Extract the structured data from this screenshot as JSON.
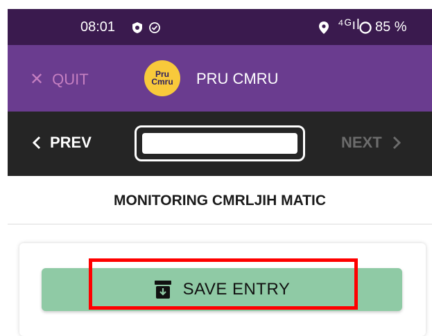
{
  "status_bar": {
    "time": "08:01",
    "signal_text": "⁴ᴳıl",
    "battery": "85 %"
  },
  "header": {
    "quit_label": "QUIT",
    "logo_text": "Pru Cmru",
    "app_name": "PRU CMRU"
  },
  "nav": {
    "prev_label": "PREV",
    "next_label": "NEXT",
    "page_value": ""
  },
  "form": {
    "title": "MONITORING CMRLJIH MATIC",
    "save_label": "SAVE ENTRY"
  },
  "colors": {
    "status_bg": "#3a1a4e",
    "header_bg": "#6a3c8f",
    "nav_bg": "#252525",
    "save_bg": "#8fcaa5",
    "highlight": "#ff0000"
  }
}
